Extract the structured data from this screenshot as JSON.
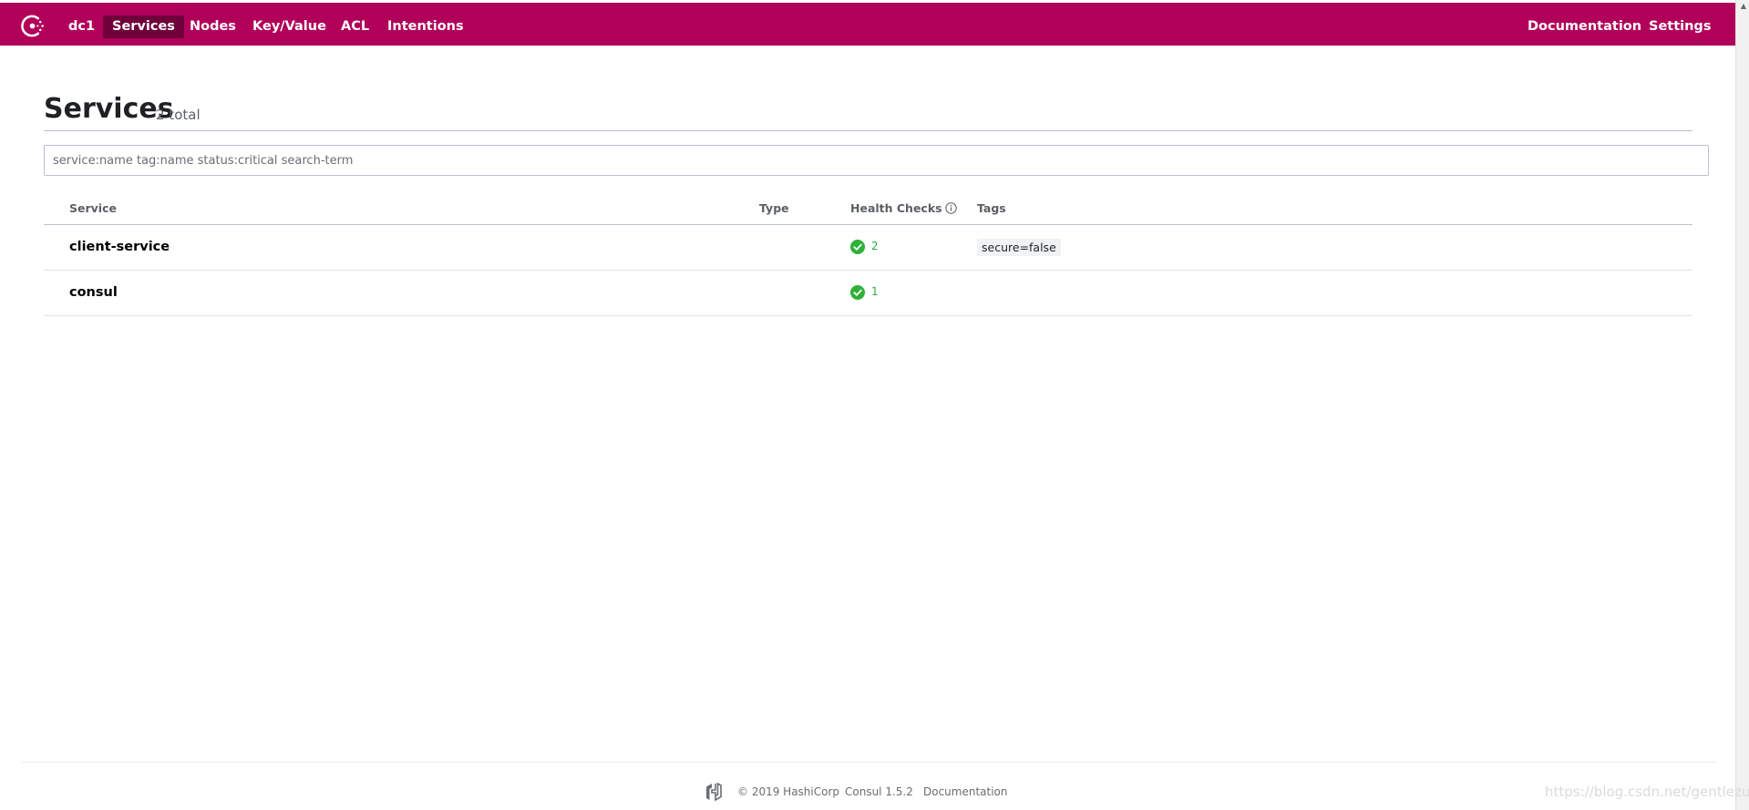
{
  "nav": {
    "datacenter": "dc1",
    "items": [
      "Services",
      "Nodes",
      "Key/Value",
      "ACL",
      "Intentions"
    ],
    "active": "Services",
    "right_items": [
      "Documentation",
      "Settings"
    ],
    "brand_color": "#b1005a"
  },
  "header": {
    "title": "Services",
    "count": "2 total"
  },
  "search": {
    "placeholder": "service:name tag:name status:critical search-term",
    "value": ""
  },
  "table": {
    "columns": [
      "Service",
      "Type",
      "Health Checks",
      "Tags"
    ],
    "rows": [
      {
        "name": "client-service",
        "type": "",
        "checks": "2",
        "check_status": "passing",
        "tags": [
          "secure=false"
        ]
      },
      {
        "name": "consul",
        "type": "",
        "checks": "1",
        "check_status": "passing",
        "tags": []
      }
    ]
  },
  "footer": {
    "copyright": "© 2019 HashiCorp",
    "version": "Consul 1.5.2",
    "docs": "Documentation"
  },
  "watermark": "https://blog.csdn.net/gentlezu..."
}
